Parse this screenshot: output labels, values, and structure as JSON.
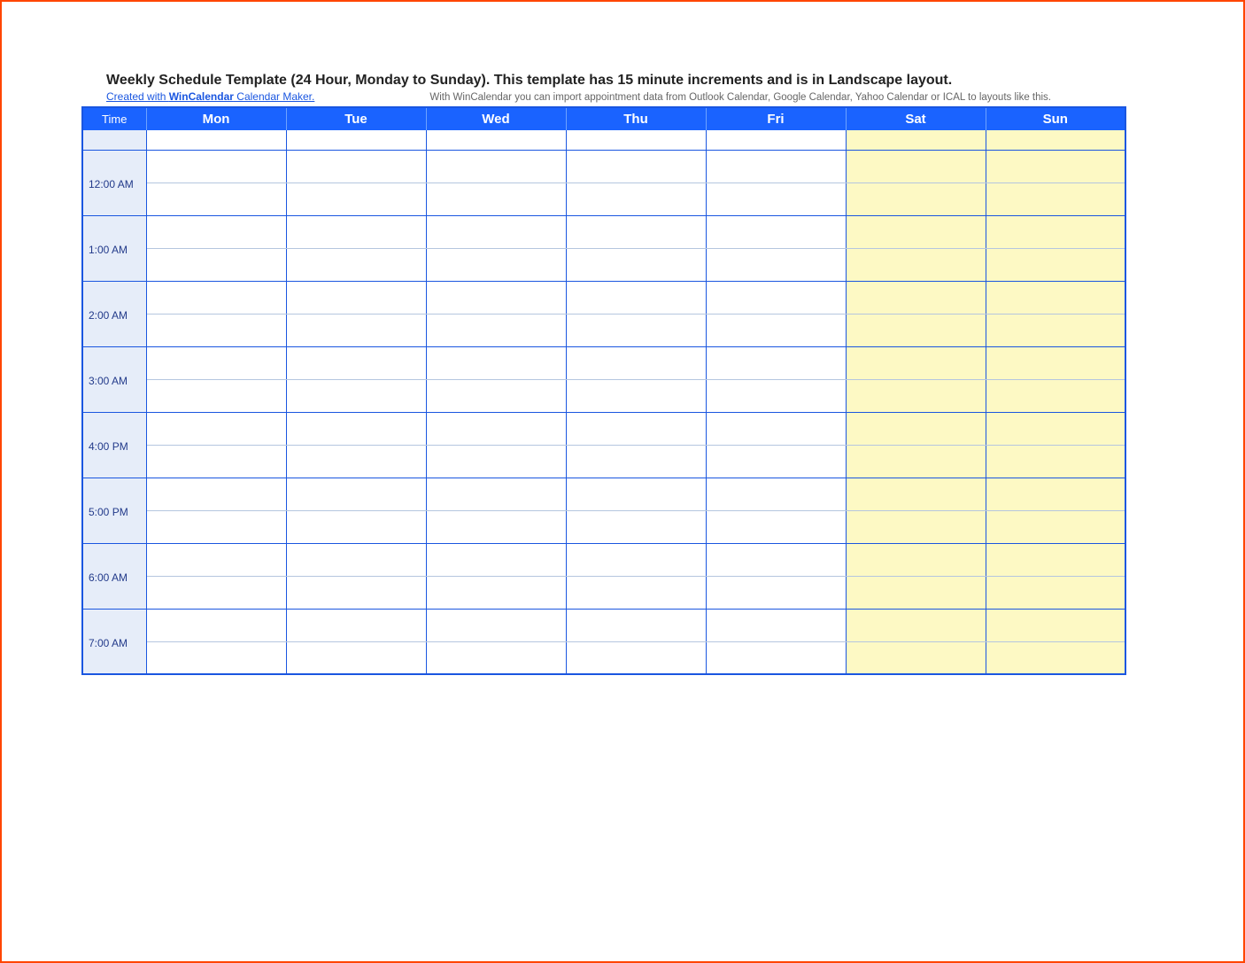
{
  "title": "Weekly Schedule Template (24 Hour, Monday to Sunday).  This template has 15 minute increments and is in Landscape layout.",
  "credit": {
    "prefix": "Created with ",
    "brand": "WinCalendar",
    "suffix": " Calendar Maker."
  },
  "note": "With WinCalendar you can import appointment data from Outlook Calendar, Google Calendar, Yahoo Calendar or ICAL to layouts like this.",
  "header": {
    "time_label": "Time",
    "days": [
      "Mon",
      "Tue",
      "Wed",
      "Thu",
      "Fri",
      "Sat",
      "Sun"
    ]
  },
  "time_rows": [
    "12:00 AM",
    "1:00 AM",
    "2:00 AM",
    "3:00 AM",
    "4:00 PM",
    "5:00 PM",
    "6:00 AM",
    "7:00 AM"
  ],
  "weekend_columns": [
    5,
    6
  ]
}
